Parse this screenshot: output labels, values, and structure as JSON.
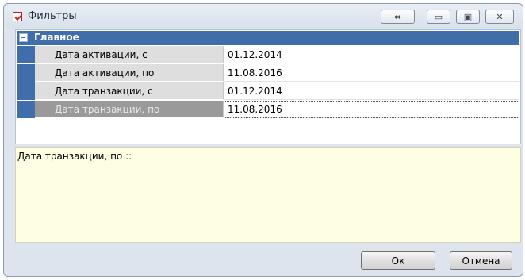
{
  "window": {
    "title": "Фильтры"
  },
  "titlebar": {
    "swap_icon": "⇔",
    "minimize_icon": "▭",
    "maximize_icon": "▣",
    "close_icon": "✕"
  },
  "group": {
    "label": "Главное"
  },
  "rows": [
    {
      "label": "Дата активации, с",
      "value": "01.12.2014"
    },
    {
      "label": "Дата активации, по",
      "value": "11.08.2016"
    },
    {
      "label": "Дата транзакции, с",
      "value": "01.12.2014"
    },
    {
      "label": "Дата транзакции, по",
      "value": "11.08.2016"
    }
  ],
  "description": {
    "text": "Дата транзакции, по ::"
  },
  "buttons": {
    "ok": "Ок",
    "cancel": "Отмена"
  },
  "colors": {
    "group_header": "#3f6eaa",
    "description_bg": "#fefee3",
    "label_bg": "#dedede",
    "selected_label_bg": "#9a9a9a"
  }
}
